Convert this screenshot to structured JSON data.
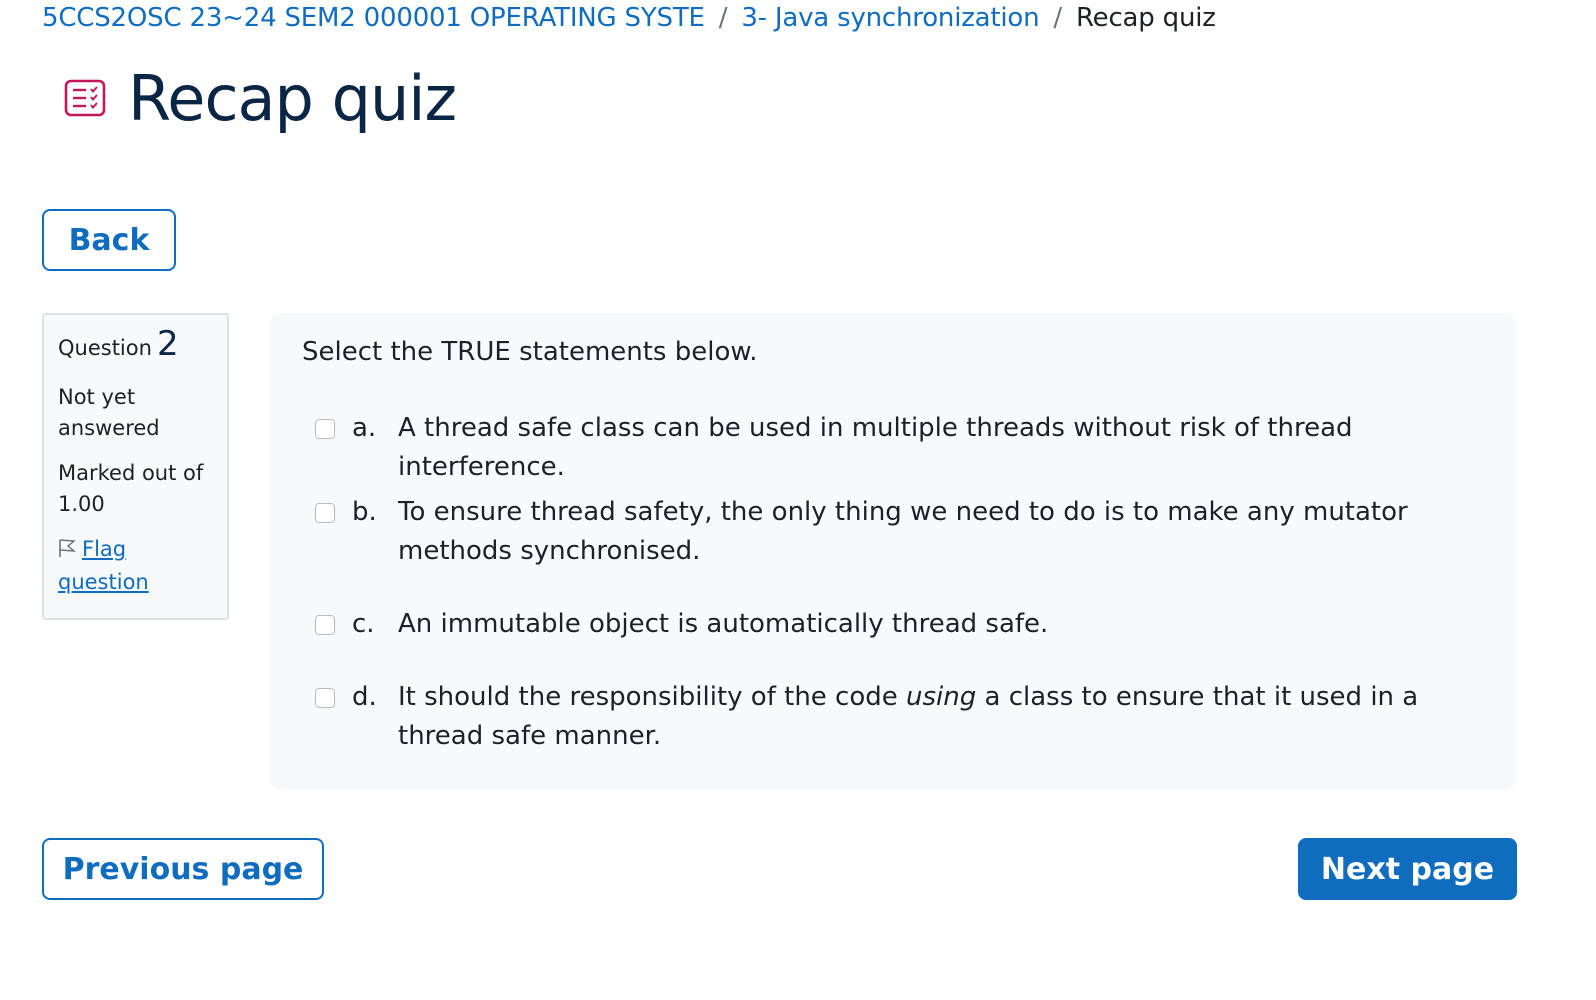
{
  "breadcrumb": {
    "course": "5CCS2OSC 23~24 SEM2 000001 OPERATING SYSTE",
    "section": "3- Java synchronization",
    "current": "Recap quiz",
    "separator": "/"
  },
  "header": {
    "title": "Recap quiz",
    "icon": "quiz-icon"
  },
  "buttons": {
    "back": "Back",
    "previous": "Previous page",
    "next": "Next page"
  },
  "question_info": {
    "label": "Question",
    "number": "2",
    "state": "Not yet answered",
    "grade": "Marked out of 1.00",
    "flag": "Flag question"
  },
  "question": {
    "text": "Select the TRUE statements below.",
    "answers": [
      {
        "letter": "a.",
        "text": "A thread safe class can be used in multiple threads without risk of thread interference."
      },
      {
        "letter": "b.",
        "text": "To ensure thread safety, the only thing we need to do is to make any mutator methods synchronised."
      },
      {
        "letter": "c.",
        "text": "An immutable object is automatically thread safe."
      },
      {
        "letter": "d.",
        "text_before": "It should the responsibility of the code ",
        "text_italic": "using",
        "text_after": " a class to ensure that it used in a thread safe manner."
      }
    ]
  },
  "colors": {
    "link": "#0f6cbf",
    "title": "#0b2545",
    "icon": "#c2185b",
    "panel": "#f8f9fc"
  }
}
